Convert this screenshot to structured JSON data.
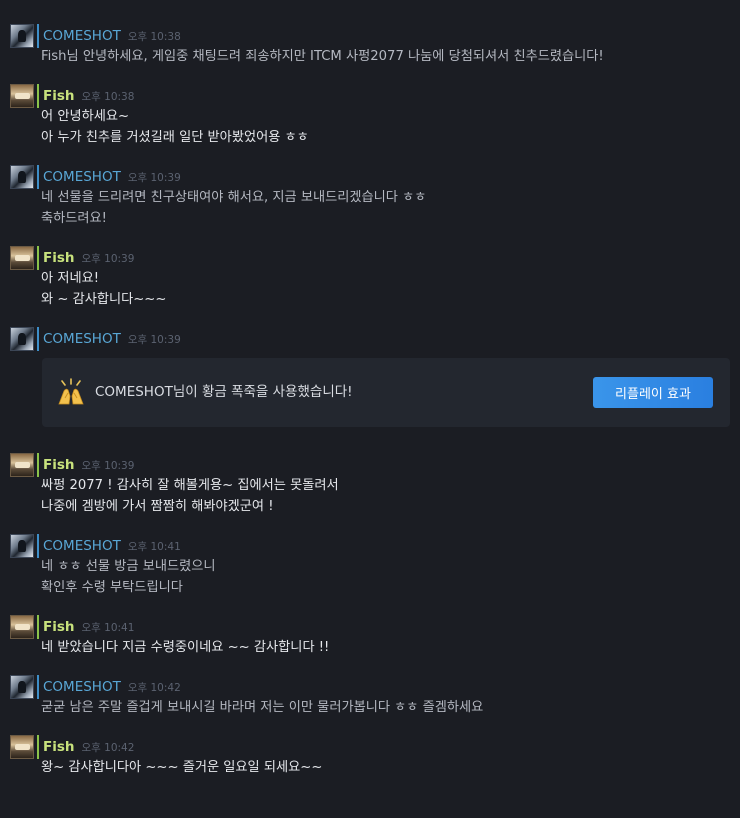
{
  "colors": {
    "background": "#1b1d23",
    "comeshot_name": "#59a7d6",
    "fish_name": "#c8e27d",
    "timestamp": "#5b6270",
    "replay_button": "#2a7fe0"
  },
  "messages": [
    {
      "author": "COMESHOT",
      "time": "오후 10:38",
      "avatar": "comeshot-avatar",
      "lines": [
        "Fish님 안녕하세요, 게임중 채팅드려 죄송하지만 ITCM 사펑2077 나눔에 당첨되셔서 친추드렸습니다!"
      ]
    },
    {
      "author": "Fish",
      "time": "오후 10:38",
      "avatar": "fish-avatar",
      "lines": [
        "어 안녕하세요~",
        "아 누가 친추를 거셨길래 일단 받아봤었어용 ㅎㅎ"
      ]
    },
    {
      "author": "COMESHOT",
      "time": "오후 10:39",
      "avatar": "comeshot-avatar",
      "lines": [
        "네 선물을 드리려면 친구상태여야 해서요, 지금 보내드리겠습니다 ㅎㅎ",
        "축하드려요!"
      ]
    },
    {
      "author": "Fish",
      "time": "오후 10:39",
      "avatar": "fish-avatar",
      "lines": [
        "아 저네요!",
        "와 ~ 감사합니다~~~"
      ]
    },
    {
      "author": "COMESHOT",
      "time": "오후 10:39",
      "avatar": "comeshot-avatar",
      "lines": []
    },
    {
      "author": "Fish",
      "time": "오후 10:39",
      "avatar": "fish-avatar",
      "lines": [
        "싸펑 2077 ! 감사히 잘 해볼게용~ 집에서는 못돌려서",
        "나중에 겜방에 가서 짬짬히 해봐야겠군여 !"
      ]
    },
    {
      "author": "COMESHOT",
      "time": "오후 10:41",
      "avatar": "comeshot-avatar",
      "lines": [
        "네 ㅎㅎ 선물 방금 보내드렸으니",
        "확인후 수령 부탁드립니다"
      ]
    },
    {
      "author": "Fish",
      "time": "오후 10:41",
      "avatar": "fish-avatar",
      "lines": [
        "네 받았습니다 지금 수령중이네요 ~~ 감사합니다 !!"
      ]
    },
    {
      "author": "COMESHOT",
      "time": "오후 10:42",
      "avatar": "comeshot-avatar",
      "lines": [
        "굳굳 남은 주말 즐겁게 보내시길 바라며 저는 이만 물러가봅니다 ㅎㅎ 즐겜하세요"
      ]
    },
    {
      "author": "Fish",
      "time": "오후 10:42",
      "avatar": "fish-avatar",
      "lines": [
        "왕~ 감사합니다아 ~~~ 즐거운 일요일 되세요~~"
      ]
    }
  ],
  "effect": {
    "icon": "applause-hands-icon",
    "text": "COMESHOT님이 황금 폭죽을 사용했습니다!",
    "replay_label": "리플레이 효과"
  }
}
